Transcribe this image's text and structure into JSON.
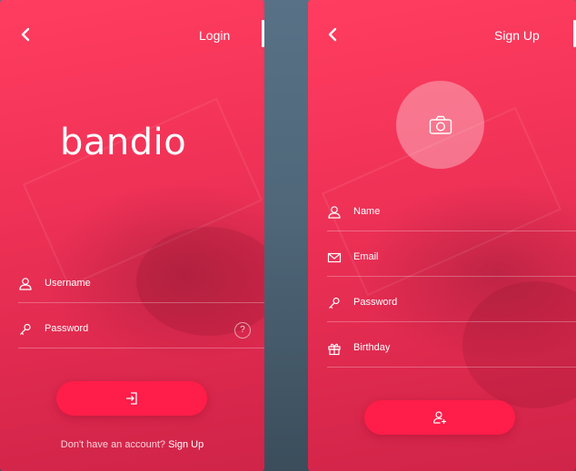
{
  "login": {
    "title": "Login",
    "logo_text": "bandio",
    "username": {
      "label": "Username",
      "icon": "user-icon"
    },
    "password": {
      "label": "Password",
      "icon": "key-icon",
      "help": "?"
    },
    "submit_icon": "login-icon",
    "prompt_text": "Don't have an account?",
    "signup_link": "Sign Up"
  },
  "signup": {
    "title": "Sign Up",
    "avatar_icon": "camera-icon",
    "fields": [
      {
        "label": "Name",
        "icon": "user-icon"
      },
      {
        "label": "Email",
        "icon": "mail-icon"
      },
      {
        "label": "Password",
        "icon": "key-icon"
      },
      {
        "label": "Birthday",
        "icon": "gift-icon"
      }
    ],
    "submit_icon": "add-user-icon"
  },
  "colors": {
    "primary": "#f23358",
    "button": "#ff1d49",
    "background": "#587186"
  }
}
